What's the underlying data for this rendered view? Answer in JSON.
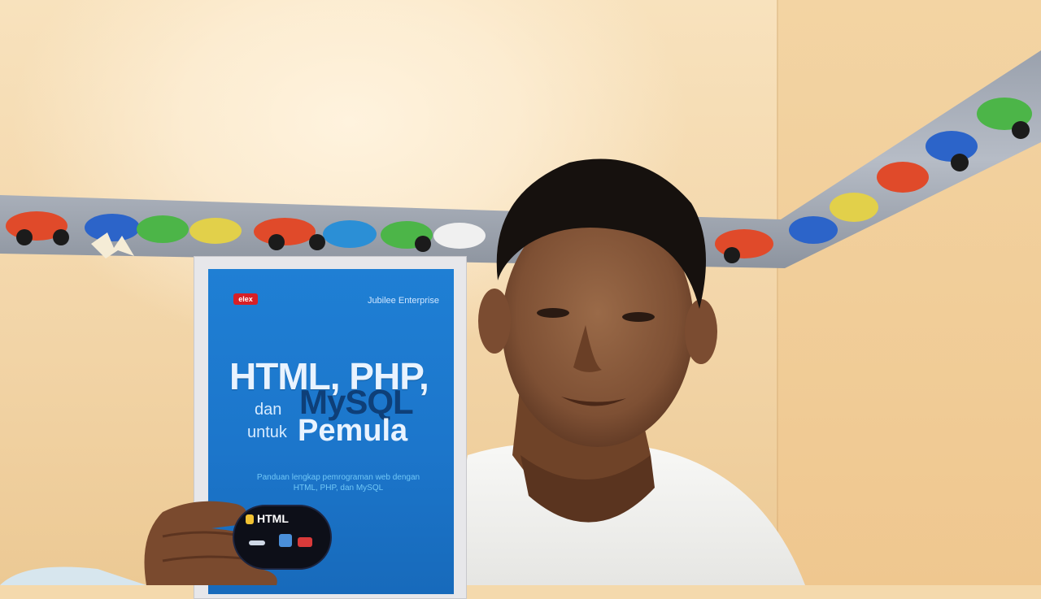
{
  "image": {
    "description_colors": {
      "wall": "#f4d9ac",
      "book_blue": "#1c76cb",
      "shirt": "#f3f3f1",
      "skin": "#8a5a3c",
      "hair": "#16110e"
    }
  },
  "book": {
    "publisher_logo": "elex",
    "author": "Jubilee Enterprise",
    "title_line1": "HTML, PHP,",
    "title_dan": "dan",
    "title_mysql": "MySQL",
    "title_untuk": "untuk",
    "title_pemula": "Pemula",
    "subtitle_line1": "Panduan lengkap pemrograman web dengan",
    "subtitle_line2": "HTML, PHP, dan MySQL",
    "badge_label": "HTML"
  }
}
